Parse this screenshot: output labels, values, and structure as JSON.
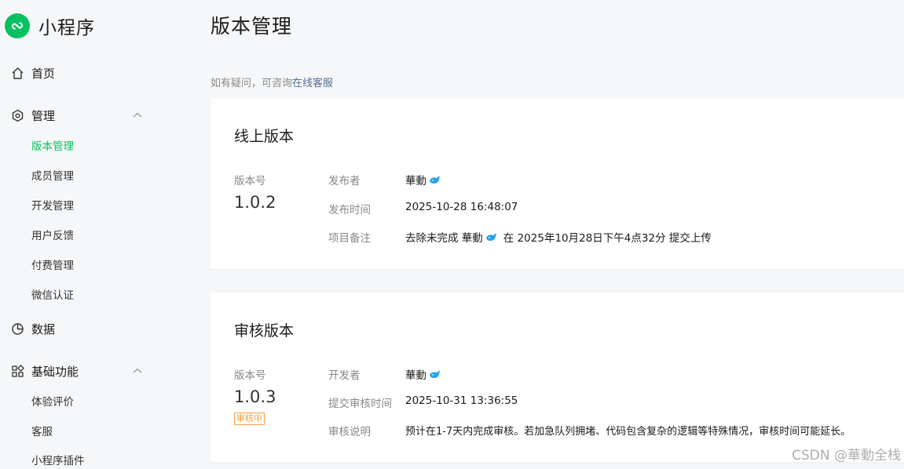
{
  "app": {
    "name": "小程序"
  },
  "sidebar": {
    "home": "首页",
    "manage": {
      "label": "管理",
      "items": [
        "版本管理",
        "成员管理",
        "开发管理",
        "用户反馈",
        "付费管理",
        "微信认证"
      ]
    },
    "data": "数据",
    "basic": {
      "label": "基础功能",
      "items": [
        "体验评价",
        "客服",
        "小程序插件"
      ]
    }
  },
  "page": {
    "title": "版本管理",
    "help_prefix": "如有疑问，可咨询",
    "help_link": "在线客服"
  },
  "online": {
    "title": "线上版本",
    "version_label": "版本号",
    "version": "1.0.2",
    "rows": [
      {
        "key": "发布者",
        "value": "華動"
      },
      {
        "key": "发布时间",
        "value": "2025-10-28 16:48:07"
      },
      {
        "key": "项目备注",
        "value_pre": "去除未完成 華動",
        "value_post": "在 2025年10月28日下午4点32分 提交上传"
      }
    ]
  },
  "review": {
    "title": "审核版本",
    "version_label": "版本号",
    "version": "1.0.3",
    "status": "审核中",
    "rows": [
      {
        "key": "开发者",
        "value": "華動"
      },
      {
        "key": "提交审核时间",
        "value": "2025-10-31 13:36:55"
      },
      {
        "key": "审核说明",
        "value": "预计在1-7天内完成审核。若加急队列拥堵、代码包含复杂的逻辑等特殊情况，审核时间可能延长。"
      }
    ]
  },
  "watermark": "CSDN @華動全栈",
  "colors": {
    "accent": "#07c160",
    "link": "#576b95",
    "warning": "#fa9d3b"
  }
}
